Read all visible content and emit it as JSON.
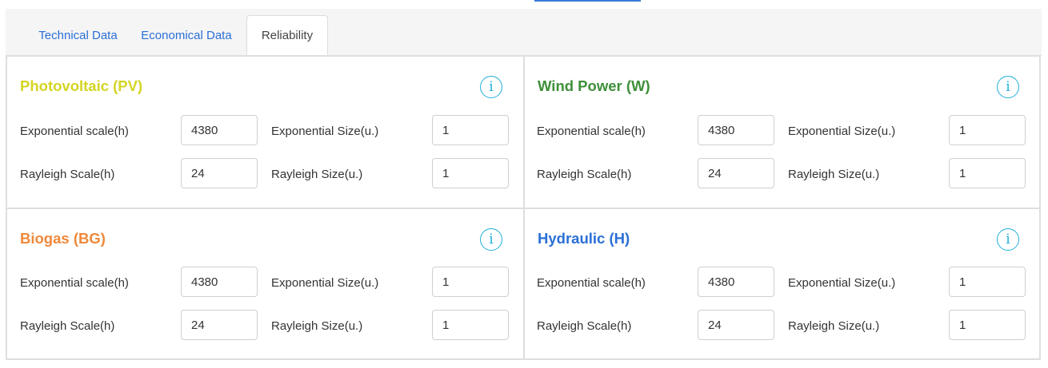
{
  "tabs": [
    {
      "label": "Technical Data"
    },
    {
      "label": "Economical Data"
    },
    {
      "label": "Reliability"
    }
  ],
  "active_tab": "Reliability",
  "panels": [
    {
      "title": "Photovoltaic (PV)",
      "color": "#d4d422",
      "exp_scale_label": "Exponential scale(h)",
      "exp_scale_value": "4380",
      "exp_size_label": "Exponential Size(u.)",
      "exp_size_value": "1",
      "ray_scale_label": "Rayleigh Scale(h)",
      "ray_scale_value": "24",
      "ray_size_label": "Rayleigh Size(u.)",
      "ray_size_value": "1",
      "info_glyph": "i"
    },
    {
      "title": "Wind Power (W)",
      "color": "#3f8f3a",
      "exp_scale_label": "Exponential scale(h)",
      "exp_scale_value": "4380",
      "exp_size_label": "Exponential Size(u.)",
      "exp_size_value": "1",
      "ray_scale_label": "Rayleigh Scale(h)",
      "ray_scale_value": "24",
      "ray_size_label": "Rayleigh Size(u.)",
      "ray_size_value": "1",
      "info_glyph": "i"
    },
    {
      "title": "Biogas (BG)",
      "color": "#f0883a",
      "exp_scale_label": "Exponential scale(h)",
      "exp_scale_value": "4380",
      "exp_size_label": "Exponential Size(u.)",
      "exp_size_value": "1",
      "ray_scale_label": "Rayleigh Scale(h)",
      "ray_scale_value": "24",
      "ray_size_label": "Rayleigh Size(u.)",
      "ray_size_value": "1",
      "info_glyph": "i"
    },
    {
      "title": "Hydraulic (H)",
      "color": "#2a6fd6",
      "exp_scale_label": "Exponential scale(h)",
      "exp_scale_value": "4380",
      "exp_size_label": "Exponential Size(u.)",
      "exp_size_value": "1",
      "ray_scale_label": "Rayleigh Scale(h)",
      "ray_scale_value": "24",
      "ray_size_label": "Rayleigh Size(u.)",
      "ray_size_value": "1",
      "info_glyph": "i"
    }
  ],
  "colors": {
    "link": "#2a6fd6",
    "info": "#1fb0d8",
    "border": "#dedede"
  }
}
